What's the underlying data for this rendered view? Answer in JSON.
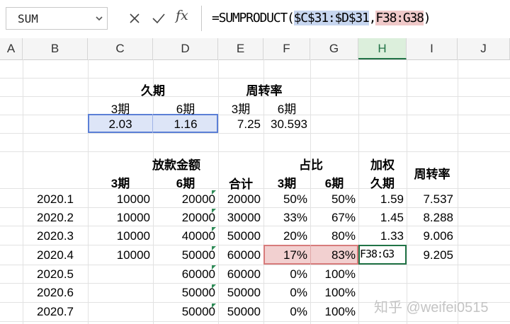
{
  "formula_bar": {
    "name_box": "SUM",
    "fx_label": "fx",
    "formula_prefix": "=SUMPRODUCT(",
    "formula_ref1": "$C$31:$D$31",
    "formula_sep": ",",
    "formula_ref2": "F38:G38",
    "formula_suffix": ")"
  },
  "columns": [
    "A",
    "B",
    "C",
    "D",
    "E",
    "F",
    "G",
    "H",
    "I",
    "J"
  ],
  "top_table": {
    "header_jiuqi": "久期",
    "header_zhouzhuan": "周转率",
    "sub_c": "3期",
    "sub_d": "6期",
    "sub_e": "3期",
    "sub_f": "6期",
    "val_c": "2.03",
    "val_d": "1.16",
    "val_e": "7.25",
    "val_f": "30.593"
  },
  "main_table": {
    "header_amount": "放款金额",
    "header_ratio": "占比",
    "header_weighted_1": "加权",
    "header_weighted_2": "久期",
    "header_turnover": "周转率",
    "sub_c": "3期",
    "sub_d": "6期",
    "sub_e": "合计",
    "sub_f": "3期",
    "sub_g": "6期",
    "rows": [
      {
        "period": "2020.1",
        "c": "10000",
        "d": "20000",
        "e": "20000",
        "f": "50%",
        "g": "50%",
        "h": "1.59",
        "i": "7.537"
      },
      {
        "period": "2020.2",
        "c": "10000",
        "d": "20000",
        "e": "30000",
        "f": "33%",
        "g": "67%",
        "h": "1.45",
        "i": "8.288"
      },
      {
        "period": "2020.3",
        "c": "10000",
        "d": "40000",
        "e": "50000",
        "f": "20%",
        "g": "80%",
        "h": "1.33",
        "i": "9.006"
      },
      {
        "period": "2020.4",
        "c": "10000",
        "d": "50000",
        "e": "60000",
        "f": "17%",
        "g": "83%",
        "h": "F38:G3",
        "i": "9.205"
      },
      {
        "period": "2020.5",
        "c": "",
        "d": "60000",
        "e": "60000",
        "f": "0%",
        "g": "100%",
        "h": "",
        "i": ""
      },
      {
        "period": "2020.6",
        "c": "",
        "d": "50000",
        "e": "50000",
        "f": "0%",
        "g": "100%",
        "h": "",
        "i": ""
      },
      {
        "period": "2020.7",
        "c": "",
        "d": "50000",
        "e": "50000",
        "f": "0%",
        "g": "100%",
        "h": "",
        "i": ""
      }
    ]
  },
  "watermark": "知乎 @weifei0515",
  "colors": {
    "accent_green": "#217346",
    "ref_blue": "#5b7fd6",
    "ref_red": "#d77b7b"
  },
  "icons": {
    "cancel": "close-icon",
    "confirm": "check-icon",
    "dropdown": "chevron-down-icon"
  }
}
